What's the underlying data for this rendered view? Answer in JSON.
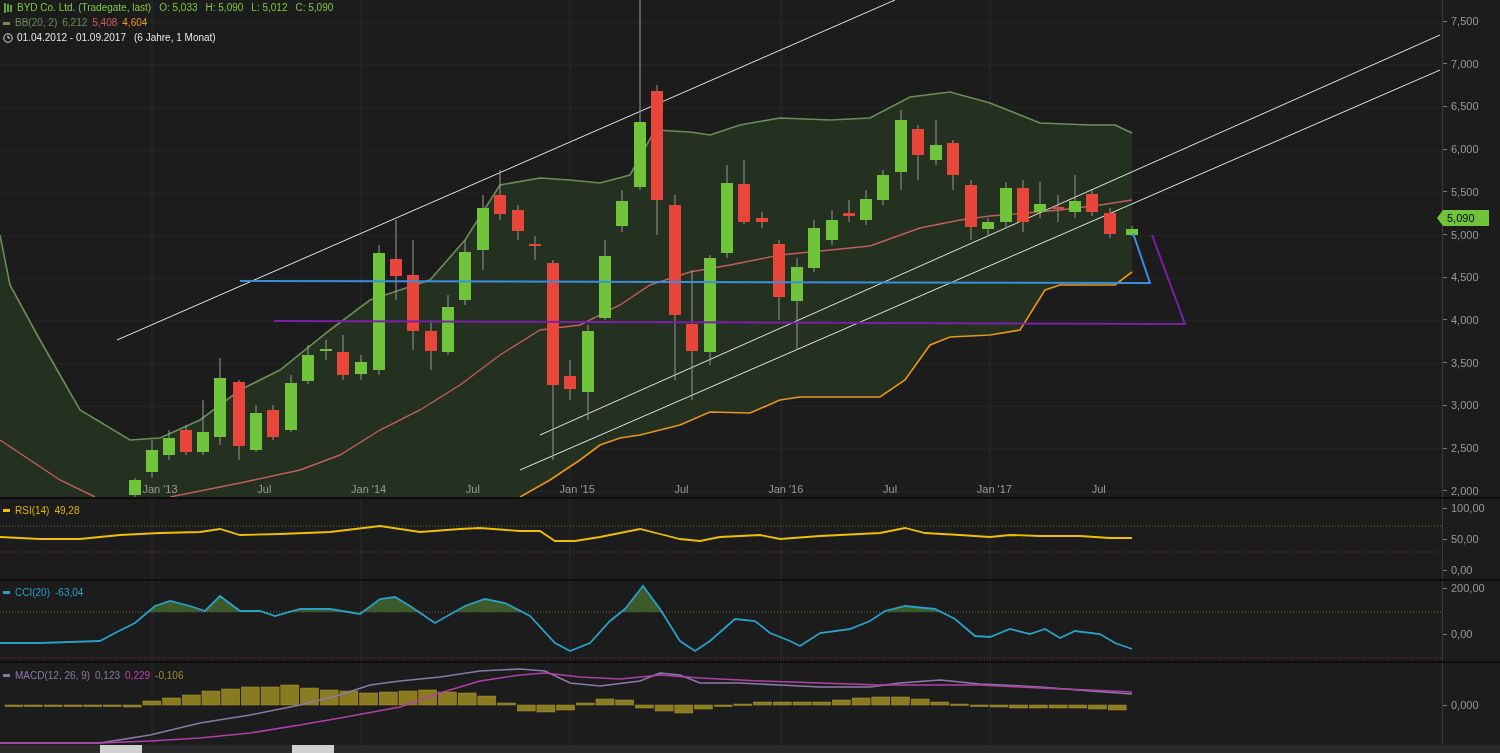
{
  "legend": {
    "title": "BYD Co. Ltd. (Tradegate, last)",
    "ohlc": [
      {
        "label": "O:",
        "value": "5,033"
      },
      {
        "label": "H:",
        "value": "5,090"
      },
      {
        "label": "L:",
        "value": "5,012"
      },
      {
        "label": "C:",
        "value": "5,090"
      }
    ],
    "bb": {
      "label": "BB(20, 2)",
      "upper": "6,212",
      "middle": "5,408",
      "lower": "4,604"
    },
    "range": {
      "dates": "01.04.2012 - 01.09.2017",
      "duration": "(6 Jahre, 1 Monat)"
    }
  },
  "price_axis": [
    "7,500",
    "7,000",
    "6,500",
    "6,000",
    "5,500",
    "5,000",
    "4,500",
    "4,000",
    "3,500",
    "3,000",
    "2,500",
    "2,000"
  ],
  "last_price": "5,090",
  "time_axis": [
    "Jan '13",
    "Jul",
    "Jan '14",
    "Jul",
    "Jan '15",
    "Jul",
    "Jan '16",
    "Jul",
    "Jan '17",
    "Jul"
  ],
  "rsi": {
    "label": "RSI(14)",
    "value": "49,28",
    "axis": [
      "100,00",
      "50,00",
      "0,00"
    ]
  },
  "cci": {
    "label": "CCI(20)",
    "value": "-63,04",
    "axis": [
      "200,00",
      "0,00"
    ]
  },
  "macd": {
    "label": "MACD(12, 26, 9)",
    "macd": "0,123",
    "signal": "0,229",
    "histogram": "-0,106",
    "axis": [
      "0,000"
    ]
  }
}
